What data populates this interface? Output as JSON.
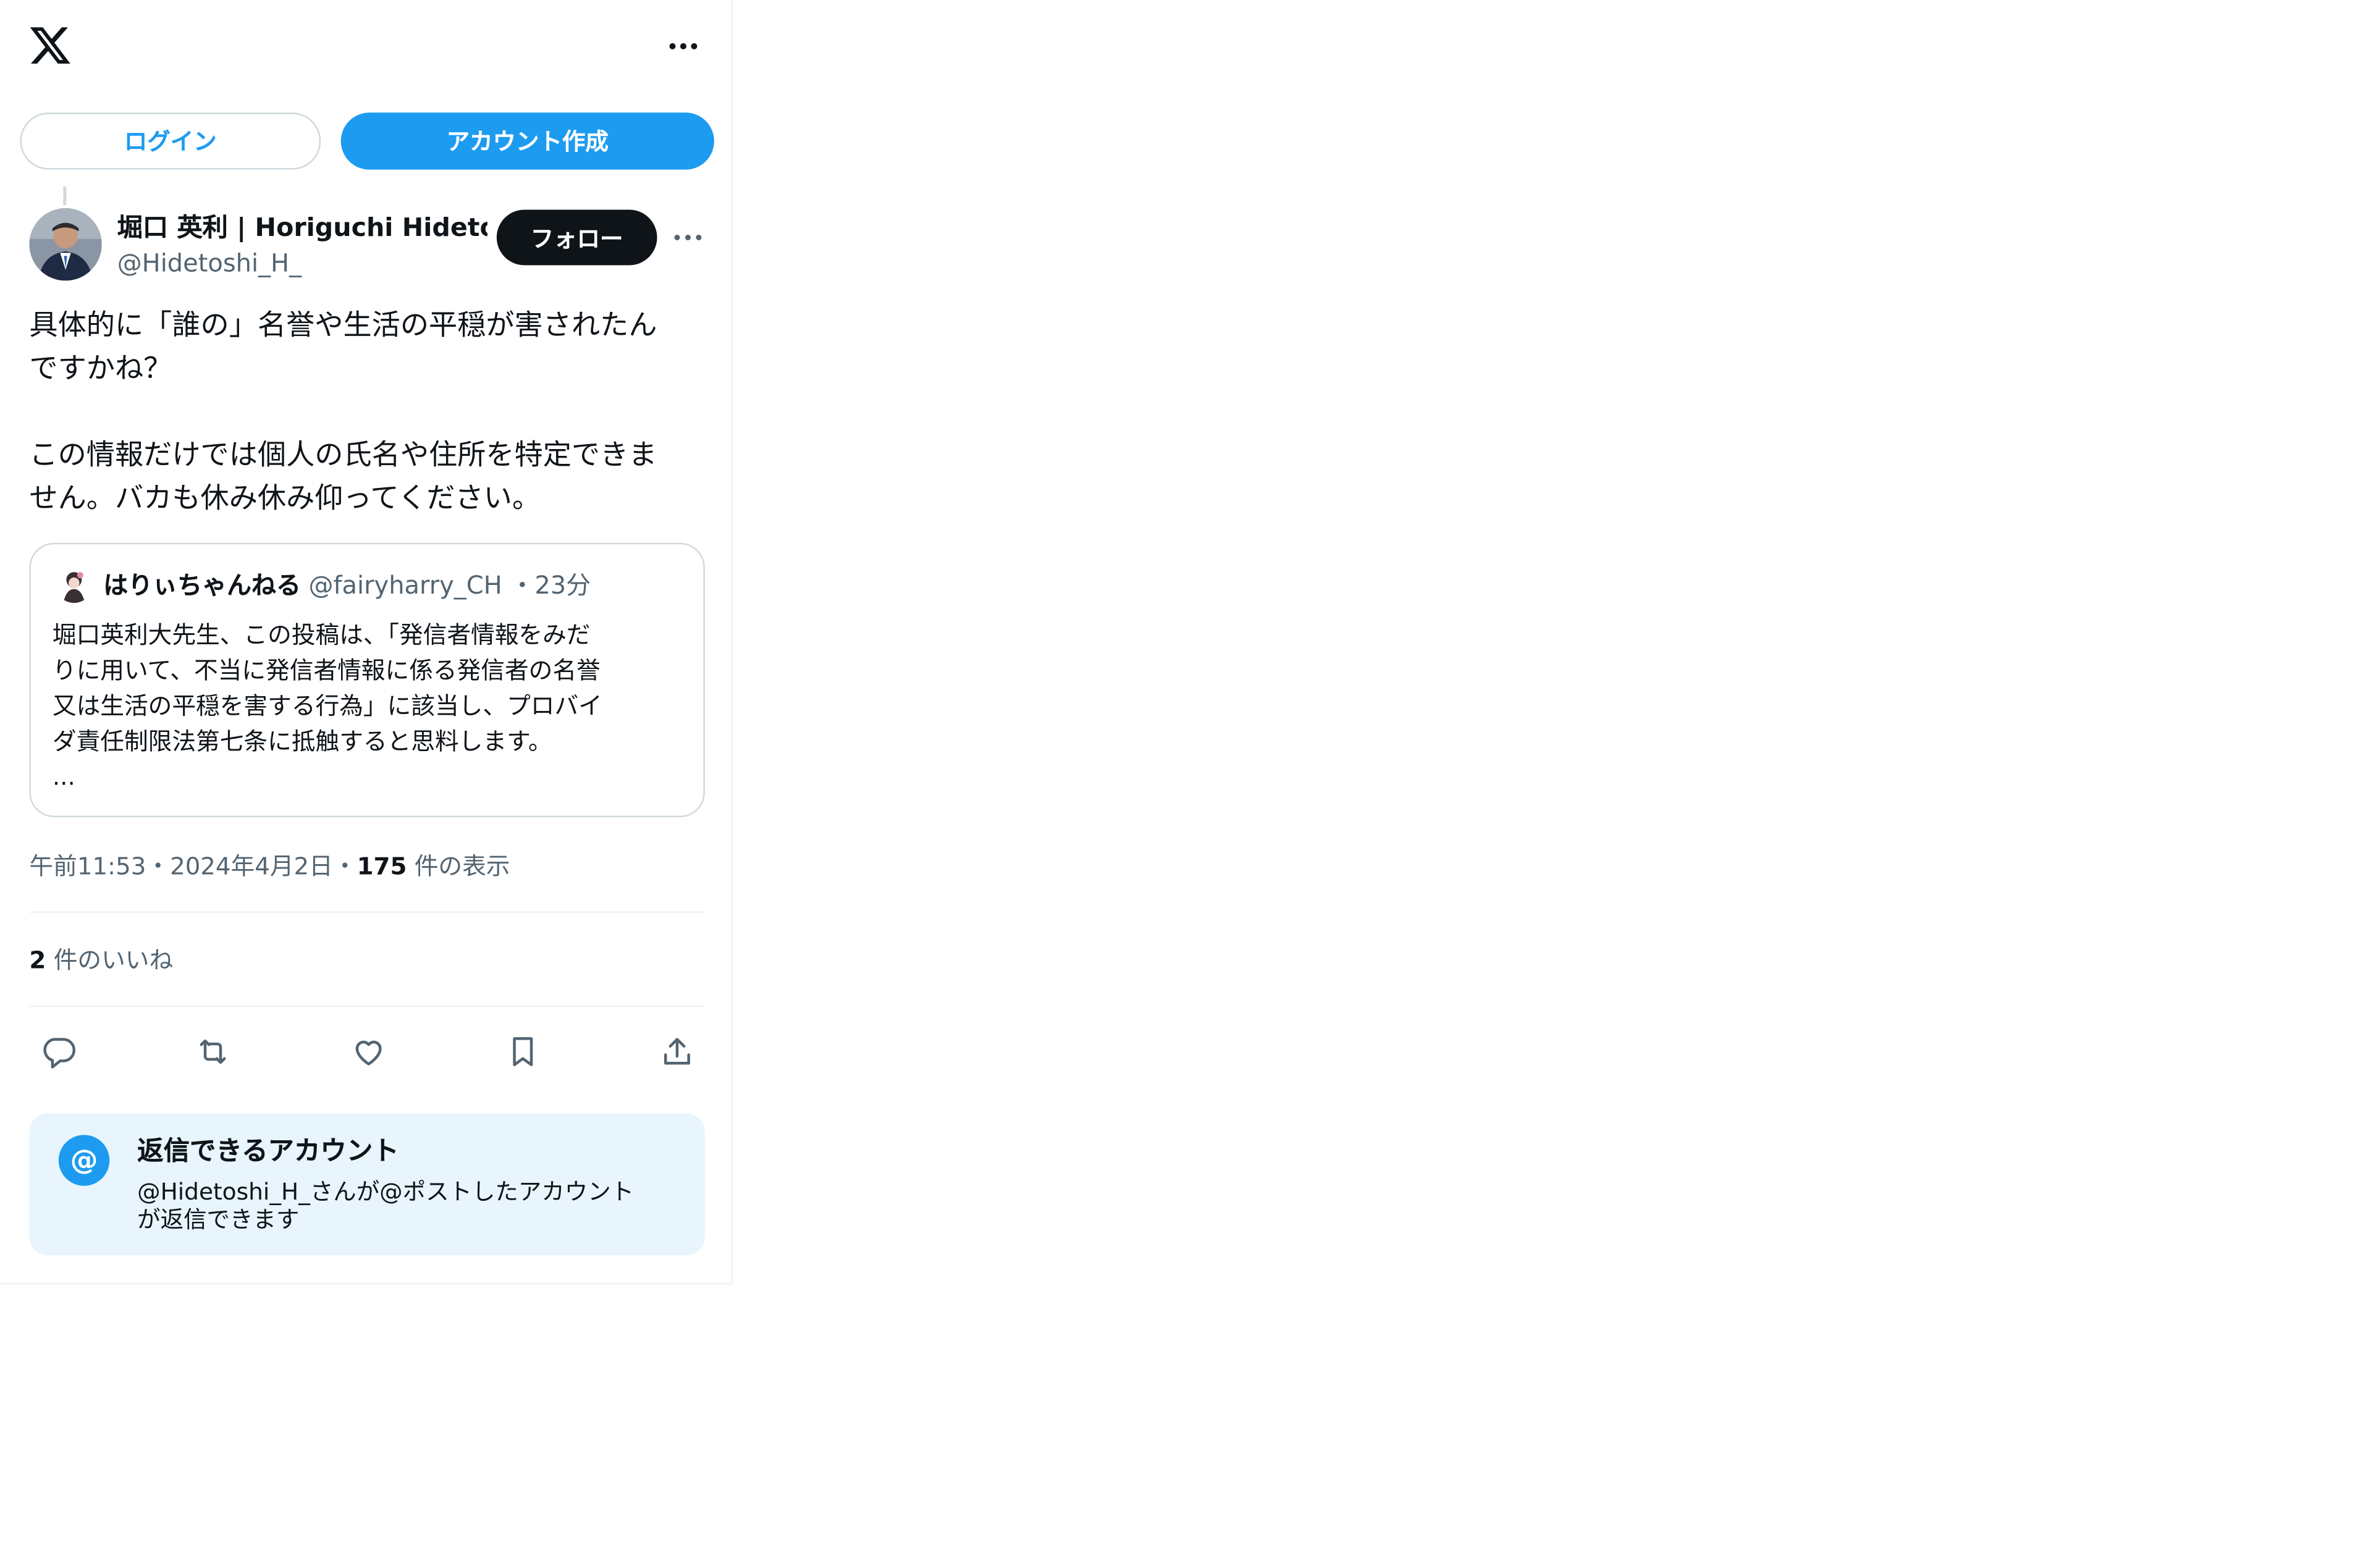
{
  "header": {
    "logo_icon": "x-logo-icon",
    "more_icon": "more-horizontal-icon"
  },
  "auth": {
    "login_label": "ログイン",
    "signup_label": "アカウント作成"
  },
  "tweet": {
    "author_name": "堀口 英利 | Horiguchi Hidetos",
    "author_handle": "@Hidetoshi_H_",
    "follow_label": "フォロー",
    "body": "具体的に「誰の」名誉や生活の平穏が害されたん\nですかね？\n\nこの情報だけでは個人の氏名や住所を特定できま\nせん。バカも休み休み仰ってください。",
    "quote": {
      "name": "はりぃちゃんねる",
      "handle": "@fairyharry_CH",
      "separator": "・",
      "time": "23分",
      "text": "堀口英利大先生、この投稿は、「発信者情報をみだ\nりに用いて、不当に発信者情報に係る発信者の名誉\n又は生活の平穏を害する行為」に該当し、プロバイ\nダ責任制限法第七条に抵触すると思料します。\n..."
    },
    "time": "午前11:53",
    "date_sep": "・",
    "date": "2024年4月2日",
    "views_sep": "・",
    "views_count": "175",
    "views_label": "件の表示",
    "likes_count": "2",
    "likes_label": "件のいいね"
  },
  "actions": {
    "reply_icon": "reply-icon",
    "retweet_icon": "retweet-icon",
    "like_icon": "heart-icon",
    "bookmark_icon": "bookmark-icon",
    "share_icon": "share-icon"
  },
  "reply_restriction": {
    "icon_glyph": "@",
    "title": "返信できるアカウント",
    "description": "@Hidetoshi_H_さんが@ポストしたアカウント\nが返信できます"
  },
  "colors": {
    "accent": "#1d9bf0",
    "text": "#0f1419",
    "muted": "#536471",
    "border": "#cfd9de",
    "reply_bg": "#e8f5fd"
  }
}
